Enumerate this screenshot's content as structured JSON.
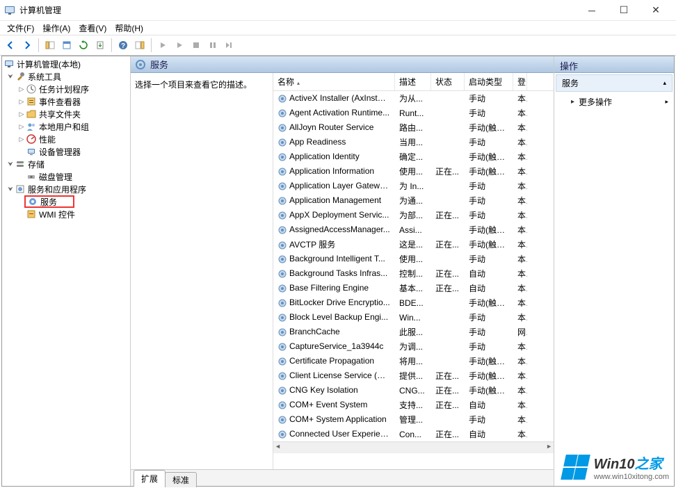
{
  "window": {
    "title": "计算机管理"
  },
  "menubar": {
    "file": "文件(F)",
    "action": "操作(A)",
    "view": "查看(V)",
    "help": "帮助(H)"
  },
  "tree": {
    "root": "计算机管理(本地)",
    "systools": "系统工具",
    "taskscheduler": "任务计划程序",
    "eventviewer": "事件查看器",
    "sharedfolders": "共享文件夹",
    "localusers": "本地用户和组",
    "performance": "性能",
    "devicemanager": "设备管理器",
    "storage": "存储",
    "diskmgmt": "磁盘管理",
    "servicesapps": "服务和应用程序",
    "services": "服务",
    "wmi": "WMI 控件"
  },
  "mid": {
    "header": "服务",
    "desc_prompt": "选择一个项目来查看它的描述。",
    "columns": {
      "name": "名称",
      "desc": "描述",
      "status": "状态",
      "startup": "启动类型",
      "logon": "登"
    },
    "tabs": {
      "extended": "扩展",
      "standard": "标准"
    }
  },
  "actions": {
    "header": "操作",
    "sub": "服务",
    "more": "更多操作"
  },
  "services": [
    {
      "name": "ActiveX Installer (AxInstSV)",
      "desc": "为从...",
      "status": "",
      "startup": "手动",
      "logon": "本"
    },
    {
      "name": "Agent Activation Runtime...",
      "desc": "Runt...",
      "status": "",
      "startup": "手动",
      "logon": "本"
    },
    {
      "name": "AllJoyn Router Service",
      "desc": "路由...",
      "status": "",
      "startup": "手动(触发...",
      "logon": "本"
    },
    {
      "name": "App Readiness",
      "desc": "当用...",
      "status": "",
      "startup": "手动",
      "logon": "本"
    },
    {
      "name": "Application Identity",
      "desc": "确定...",
      "status": "",
      "startup": "手动(触发...",
      "logon": "本"
    },
    {
      "name": "Application Information",
      "desc": "使用...",
      "status": "正在...",
      "startup": "手动(触发...",
      "logon": "本"
    },
    {
      "name": "Application Layer Gatewa...",
      "desc": "为 In...",
      "status": "",
      "startup": "手动",
      "logon": "本"
    },
    {
      "name": "Application Management",
      "desc": "为通...",
      "status": "",
      "startup": "手动",
      "logon": "本"
    },
    {
      "name": "AppX Deployment Servic...",
      "desc": "为部...",
      "status": "正在...",
      "startup": "手动",
      "logon": "本"
    },
    {
      "name": "AssignedAccessManager...",
      "desc": "Assi...",
      "status": "",
      "startup": "手动(触发...",
      "logon": "本"
    },
    {
      "name": "AVCTP 服务",
      "desc": "这是...",
      "status": "正在...",
      "startup": "手动(触发...",
      "logon": "本"
    },
    {
      "name": "Background Intelligent T...",
      "desc": "使用...",
      "status": "",
      "startup": "手动",
      "logon": "本"
    },
    {
      "name": "Background Tasks Infras...",
      "desc": "控制...",
      "status": "正在...",
      "startup": "自动",
      "logon": "本"
    },
    {
      "name": "Base Filtering Engine",
      "desc": "基本...",
      "status": "正在...",
      "startup": "自动",
      "logon": "本"
    },
    {
      "name": "BitLocker Drive Encryptio...",
      "desc": "BDE...",
      "status": "",
      "startup": "手动(触发...",
      "logon": "本"
    },
    {
      "name": "Block Level Backup Engi...",
      "desc": "Win...",
      "status": "",
      "startup": "手动",
      "logon": "本"
    },
    {
      "name": "BranchCache",
      "desc": "此服...",
      "status": "",
      "startup": "手动",
      "logon": "网"
    },
    {
      "name": "CaptureService_1a3944c",
      "desc": "为调...",
      "status": "",
      "startup": "手动",
      "logon": "本"
    },
    {
      "name": "Certificate Propagation",
      "desc": "将用...",
      "status": "",
      "startup": "手动(触发...",
      "logon": "本"
    },
    {
      "name": "Client License Service (Cli...",
      "desc": "提供...",
      "status": "正在...",
      "startup": "手动(触发...",
      "logon": "本"
    },
    {
      "name": "CNG Key Isolation",
      "desc": "CNG...",
      "status": "正在...",
      "startup": "手动(触发...",
      "logon": "本"
    },
    {
      "name": "COM+ Event System",
      "desc": "支持...",
      "status": "正在...",
      "startup": "自动",
      "logon": "本"
    },
    {
      "name": "COM+ System Application",
      "desc": "管理...",
      "status": "",
      "startup": "手动",
      "logon": "本"
    },
    {
      "name": "Connected User Experien...",
      "desc": "Con...",
      "status": "正在...",
      "startup": "自动",
      "logon": "本"
    }
  ],
  "watermark": {
    "main1": "Win10",
    "main2": "之家",
    "url": "www.win10xitong.com"
  }
}
